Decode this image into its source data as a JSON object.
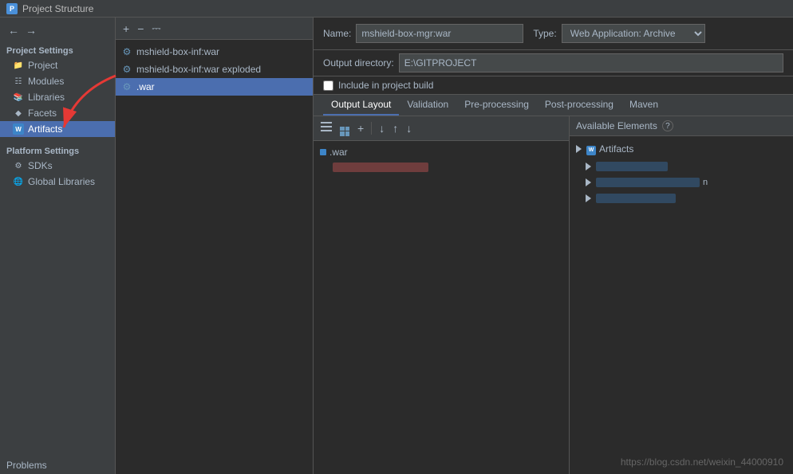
{
  "titleBar": {
    "icon": "P",
    "title": "Project Structure"
  },
  "sidebar": {
    "projectSettings": {
      "label": "Project Settings",
      "items": [
        {
          "id": "project",
          "label": "Project"
        },
        {
          "id": "modules",
          "label": "Modules"
        },
        {
          "id": "libraries",
          "label": "Libraries"
        },
        {
          "id": "facets",
          "label": "Facets"
        },
        {
          "id": "artifacts",
          "label": "Artifacts",
          "active": true
        }
      ]
    },
    "platformSettings": {
      "label": "Platform Settings",
      "items": [
        {
          "id": "sdks",
          "label": "SDKs"
        },
        {
          "id": "global-libraries",
          "label": "Global Libraries"
        }
      ]
    },
    "problems": {
      "label": "Problems"
    }
  },
  "artifactTree": {
    "items": [
      {
        "id": "war",
        "label": "mshield-box-inf:war",
        "indent": 0
      },
      {
        "id": "war-exploded",
        "label": "mshield-box-inf:war exploded",
        "indent": 0
      },
      {
        "id": "war-selected",
        "label": ".war",
        "indent": 0,
        "selected": true
      }
    ]
  },
  "settingsPanel": {
    "nameLabel": "Name:",
    "nameValue": "mshield-box-mgr:war",
    "typeLabel": "Type:",
    "typeValue": "Web Application: Archive",
    "outputDirLabel": "Output directory:",
    "outputDirValue": "E:\\GITPROJECT",
    "includeInProjectBuild": {
      "checked": false,
      "label": "Include in project build"
    },
    "tabs": [
      {
        "id": "output-layout",
        "label": "Output Layout",
        "active": true
      },
      {
        "id": "validation",
        "label": "Validation"
      },
      {
        "id": "pre-processing",
        "label": "Pre-processing"
      },
      {
        "id": "post-processing",
        "label": "Post-processing"
      },
      {
        "id": "maven",
        "label": "Maven"
      }
    ],
    "outputTree": {
      "items": [
        {
          "id": "war-root",
          "label": ".war",
          "indent": 0
        },
        {
          "id": "blurred-item",
          "label": "",
          "blurred": true,
          "indent": 1
        }
      ]
    },
    "availableElements": {
      "header": "Available Elements",
      "helpIcon": "?",
      "items": [
        {
          "id": "artifacts",
          "label": "Artifacts",
          "hasArrow": true,
          "indent": 0
        },
        {
          "id": "blurred1",
          "label": "blurred item 1",
          "blurred": true,
          "indent": 1
        },
        {
          "id": "blurred2",
          "label": "blurred item 2 n",
          "blurred": true,
          "indent": 1
        },
        {
          "id": "blurred3",
          "label": "blurred item 3",
          "blurred": true,
          "indent": 1
        }
      ]
    }
  },
  "footer": {
    "url": "https://blog.csdn.net/weixin_44000910"
  }
}
